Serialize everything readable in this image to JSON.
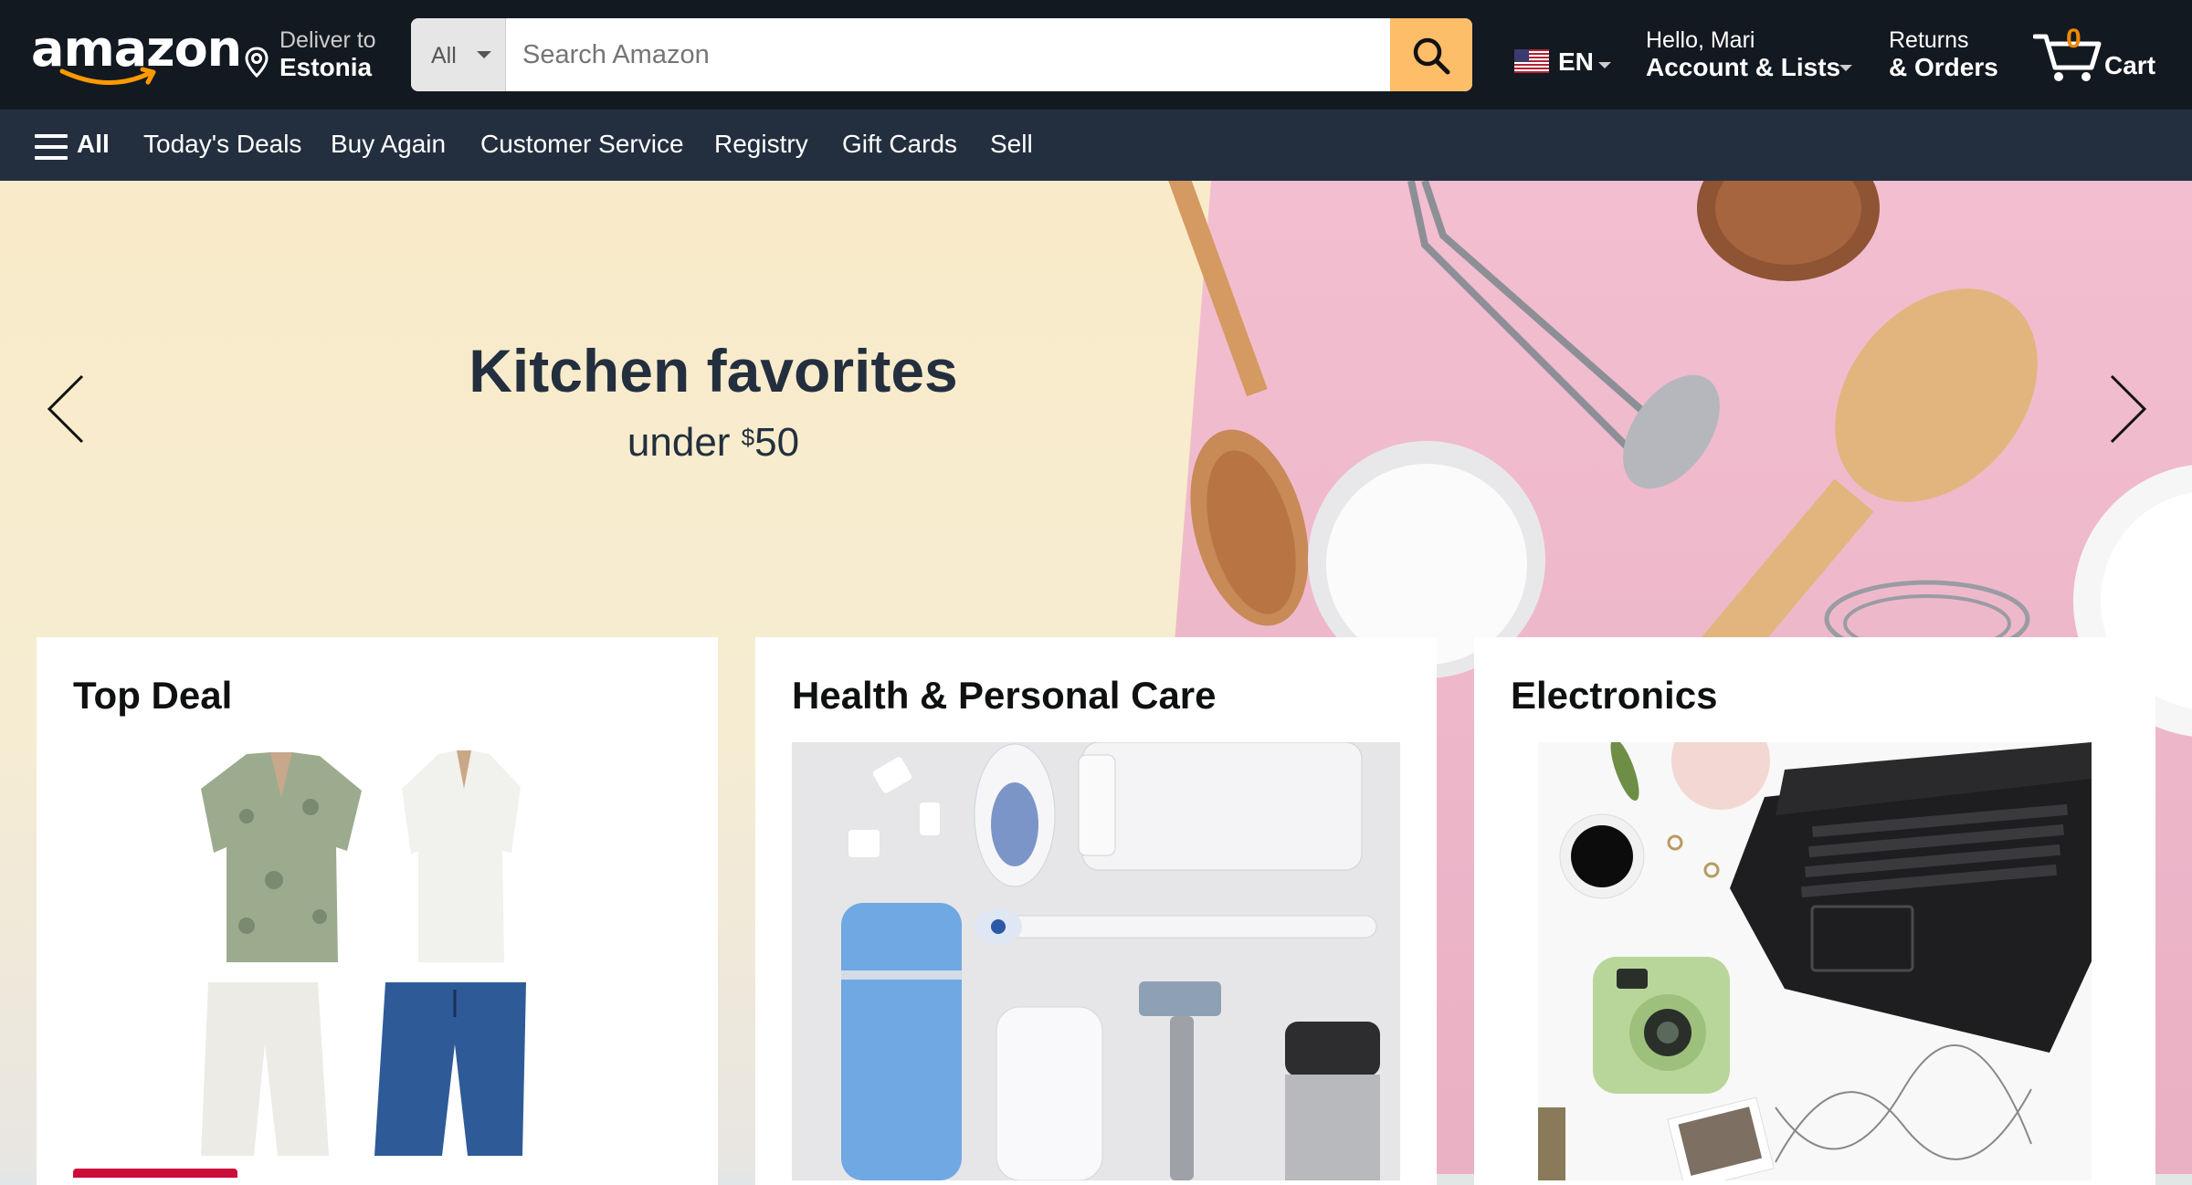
{
  "brand": {
    "logo": "amazon",
    "accent": "#febd69",
    "nav_bg": "#131921",
    "subnav_bg": "#232f3e"
  },
  "header": {
    "deliver": {
      "line1": "Deliver to",
      "line2": "Estonia"
    },
    "search": {
      "category": "All",
      "placeholder": "Search Amazon"
    },
    "language": {
      "code": "EN",
      "flag": "us-flag-icon"
    },
    "account": {
      "line1": "Hello, Mari",
      "line2": "Account & Lists"
    },
    "orders": {
      "line1": "Returns",
      "line2": "& Orders"
    },
    "cart": {
      "count": "0",
      "label": "Cart"
    }
  },
  "subnav": {
    "all_label": "All",
    "items": [
      "Today's Deals",
      "Buy Again",
      "Customer Service",
      "Registry",
      "Gift Cards",
      "Sell"
    ]
  },
  "hero": {
    "title": "Kitchen favorites",
    "subtitle_prefix": "under ",
    "subtitle_currency": "$",
    "subtitle_amount": "50"
  },
  "cards": [
    {
      "title": "Top Deal"
    },
    {
      "title": "Health & Personal Care"
    },
    {
      "title": "Electronics"
    }
  ]
}
